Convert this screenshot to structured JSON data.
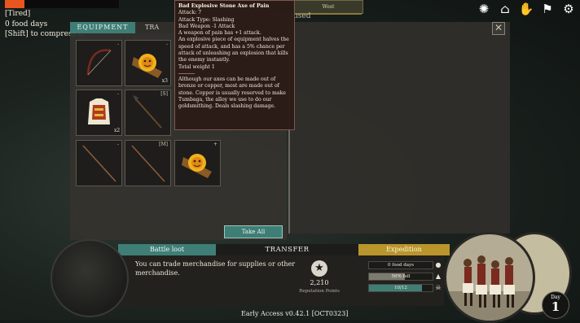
{
  "status": {
    "health_fraction": 0.17,
    "health_color": "#e8561f",
    "lines": [
      "[Tired]",
      "0 food days",
      "[Shift] to compress ti"
    ]
  },
  "compass": {
    "label": "West"
  },
  "top_icons": [
    "tribe-icon",
    "bag-icon",
    "hands-icon",
    "flag-icon",
    "gear-icon"
  ],
  "right_panel": {
    "title_partial": "used"
  },
  "equipment": {
    "tab_equipment": "EQUIPMENT",
    "tab_transfer_partial": "TRA",
    "slots": [
      {
        "icon": "bow-icon",
        "qty": "",
        "corner": "-"
      },
      {
        "icon": "stone-axe-icon",
        "qty": "x3",
        "corner": "-"
      },
      {
        "icon": "armor-vest-icon",
        "qty": "x2",
        "corner": "-"
      },
      {
        "icon": "spear-icon",
        "qty": "",
        "corner": "[S]"
      },
      {
        "icon": "stick-icon",
        "qty": "",
        "corner": "-"
      },
      {
        "icon": "stick-icon",
        "qty": "",
        "corner": "[M]"
      },
      {
        "icon": "stone-axe-icon",
        "qty": "",
        "corner": "+"
      }
    ],
    "take_all": "Take All"
  },
  "tooltip": {
    "title": "Bad Explosive Stone Axe of Pain",
    "lines": [
      "Attack: 7",
      "Attack Type: Slashing",
      "Bad Weapon -1 Attack",
      "A weapon of pain has +1 attack.",
      "An explosive piece of equipment halves the speed of attack, and has a 5% chance per attack of unleashing an explosion that kills the enemy instantly.",
      "Total weight 1"
    ],
    "description": "Although our axes can be made out of bronze or copper, most are made out of stone. Copper is usually reserved to make Tumbaga, the alloy we use to do our goldsmithing. Deals slashing damage."
  },
  "bottom": {
    "tab_battle_loot": "Battle loot",
    "tab_transfer": "TRANSFER",
    "tab_expedition": "Expedition",
    "transfer_text": "You can trade merchandise for supplies or other merchandise.",
    "reputation_value": "2,210",
    "reputation_label": "Reputation Points",
    "expedition_bars": [
      {
        "label": "0 food days",
        "fill": 0.0,
        "color": "#1a1a18",
        "icon": "apple-icon"
      },
      {
        "label": "56% full",
        "fill": 0.56,
        "color": "#7d7a70",
        "icon": "weight-icon"
      },
      {
        "label": "10/12",
        "fill": 0.83,
        "color": "#3f7e76",
        "icon": "skull-icon"
      }
    ]
  },
  "day": {
    "label": "Day",
    "number": "1"
  },
  "version": "Early Access v0.42.1 [OCT0323]"
}
